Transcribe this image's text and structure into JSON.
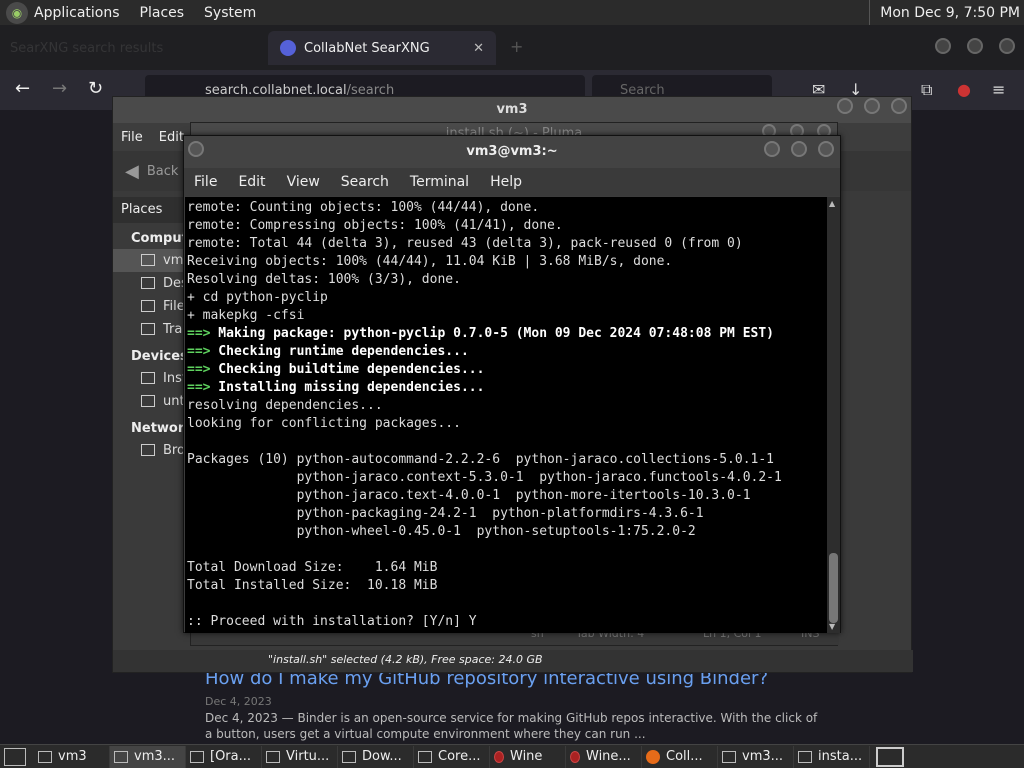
{
  "top_panel": {
    "menus": [
      "Applications",
      "Places",
      "System"
    ],
    "clock": "Mon Dec 9, 7:50 PM"
  },
  "browser": {
    "tab_inactive": "SearXNG search results",
    "tab_active": "CollabNet SearXNG",
    "url_domain": "search.collabnet.local",
    "url_path": "/search",
    "search_placeholder": "Search"
  },
  "search_result": {
    "title": "How do I make my GitHub repository interactive using Binder?",
    "date": "Dec 4, 2023",
    "snippet": "Dec 4, 2023 — Binder is an open-source service for making GitHub repos interactive. With the click of a button, users get a virtual compute environment where they can run ..."
  },
  "file_manager": {
    "title": "vm3",
    "menus": [
      "File",
      "Edit"
    ],
    "back_label": "Back",
    "places_header": "Places",
    "sections": [
      {
        "label": "Computer",
        "items": [
          {
            "label": "vm3",
            "selected": true
          },
          {
            "label": "Desktop"
          },
          {
            "label": "File System"
          },
          {
            "label": "Trash"
          }
        ]
      },
      {
        "label": "Devices",
        "items": [
          {
            "label": "Install"
          },
          {
            "label": "untitled"
          }
        ]
      },
      {
        "label": "Network",
        "items": [
          {
            "label": "Browse Network"
          }
        ]
      }
    ],
    "status": "\"install.sh\" selected (4.2 kB), Free space: 24.0 GB"
  },
  "pluma": {
    "title": "install.sh (~) - Pluma",
    "lang": "sh",
    "tab_width": "Tab Width: 4",
    "position": "Ln 1, Col 1",
    "mode": "INS"
  },
  "terminal": {
    "title": "vm3@vm3:~",
    "menus": [
      "File",
      "Edit",
      "View",
      "Search",
      "Terminal",
      "Help"
    ],
    "lines": [
      {
        "text": "remote: Counting objects: 100% (44/44), done."
      },
      {
        "text": "remote: Compressing objects: 100% (41/41), done."
      },
      {
        "text": "remote: Total 44 (delta 3), reused 43 (delta 3), pack-reused 0 (from 0)"
      },
      {
        "text": "Receiving objects: 100% (44/44), 11.04 KiB | 3.68 MiB/s, done."
      },
      {
        "text": "Resolving deltas: 100% (3/3), done."
      },
      {
        "text": "+ cd python-pyclip"
      },
      {
        "text": "+ makepkg -cfsi"
      },
      {
        "arrow": "==>",
        "text": " Making package: python-pyclip 0.7.0-5 (Mon 09 Dec 2024 07:48:08 PM EST)"
      },
      {
        "arrow": "==>",
        "text": " Checking runtime dependencies..."
      },
      {
        "arrow": "==>",
        "text": " Checking buildtime dependencies..."
      },
      {
        "arrow": "==>",
        "text": " Installing missing dependencies..."
      },
      {
        "text": "resolving dependencies..."
      },
      {
        "text": "looking for conflicting packages..."
      },
      {
        "text": ""
      },
      {
        "text": "Packages (10) python-autocommand-2.2.2-6  python-jaraco.collections-5.0.1-1"
      },
      {
        "text": "              python-jaraco.context-5.3.0-1  python-jaraco.functools-4.0.2-1"
      },
      {
        "text": "              python-jaraco.text-4.0.0-1  python-more-itertools-10.3.0-1"
      },
      {
        "text": "              python-packaging-24.2-1  python-platformdirs-4.3.6-1"
      },
      {
        "text": "              python-wheel-0.45.0-1  python-setuptools-1:75.2.0-2"
      },
      {
        "text": ""
      },
      {
        "text": "Total Download Size:    1.64 MiB"
      },
      {
        "text": "Total Installed Size:  10.18 MiB"
      },
      {
        "text": ""
      },
      {
        "text": ":: Proceed with installation? [Y/n] Y"
      }
    ]
  },
  "taskbar": {
    "items": [
      {
        "label": "vm3",
        "icon": "home-folder-icon"
      },
      {
        "label": "vm3...",
        "icon": "terminal-icon",
        "active": true
      },
      {
        "label": "[Ora...",
        "icon": "window-icon"
      },
      {
        "label": "Virtu...",
        "icon": "window-icon"
      },
      {
        "label": "Dow...",
        "icon": "folder-icon"
      },
      {
        "label": "Core...",
        "icon": "folder-icon"
      },
      {
        "label": "Wine",
        "icon": "wine-icon"
      },
      {
        "label": "Wine...",
        "icon": "wine-icon"
      },
      {
        "label": "Coll...",
        "icon": "firefox-icon"
      },
      {
        "label": "vm3...",
        "icon": "terminal-icon"
      },
      {
        "label": "insta...",
        "icon": "text-editor-icon"
      }
    ]
  },
  "colors": {
    "terminal_bg": "#000000",
    "terminal_arrow": "#5fd35f",
    "link": "#6aa0f0"
  }
}
